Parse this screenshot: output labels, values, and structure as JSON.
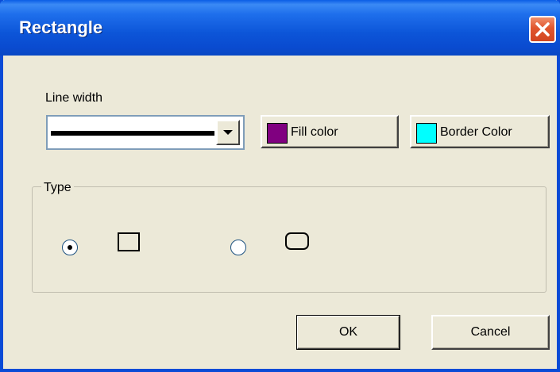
{
  "window": {
    "title": "Rectangle"
  },
  "line_width": {
    "label": "Line width",
    "selected": "thick solid line"
  },
  "buttons": {
    "fill_color": {
      "label": "Fill color",
      "swatch": "#800080"
    },
    "border_color": {
      "label": "Border Color",
      "swatch": "#00ffff"
    },
    "ok": "OK",
    "cancel": "Cancel"
  },
  "type_group": {
    "label": "Type",
    "options": [
      {
        "shape": "rectangle",
        "selected": true
      },
      {
        "shape": "rounded-rectangle",
        "selected": false
      }
    ]
  },
  "icons": {
    "close": "close-icon"
  }
}
